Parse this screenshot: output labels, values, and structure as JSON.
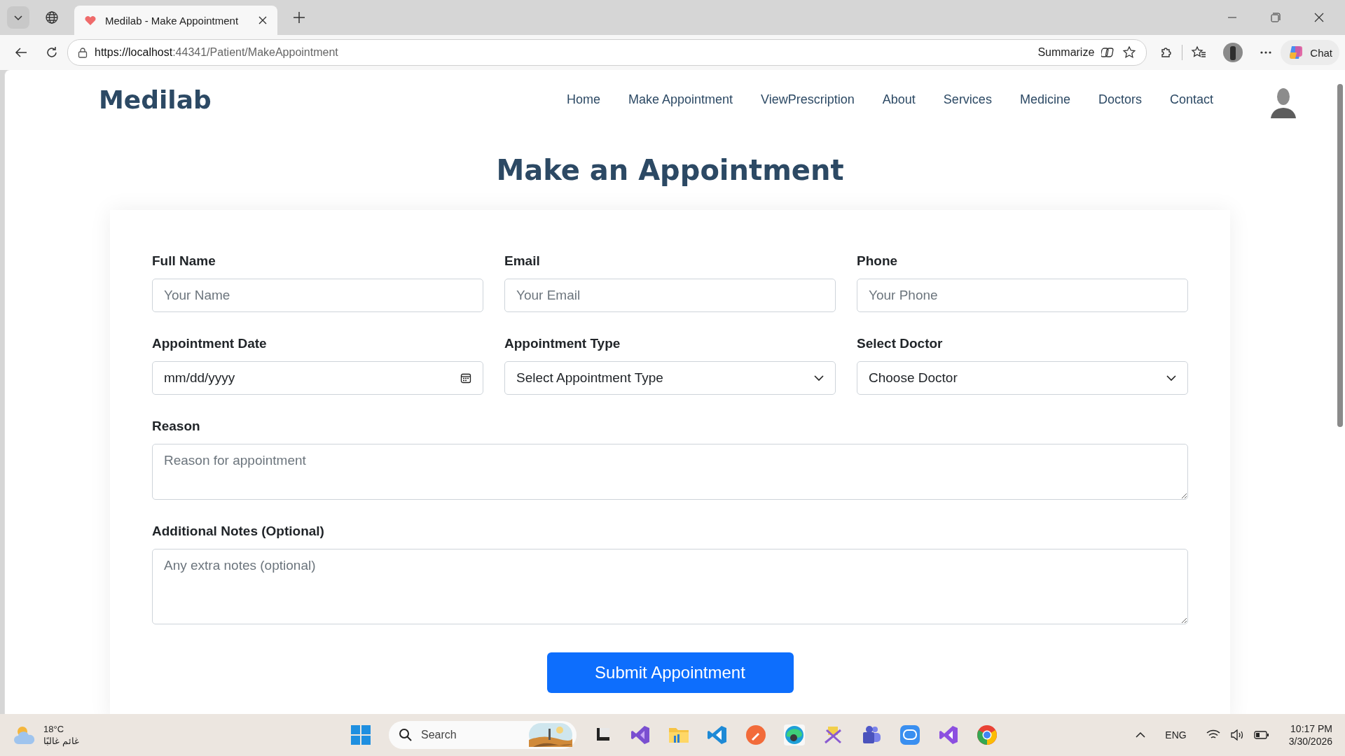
{
  "browser": {
    "tabs": [
      {
        "title": "Medilab - Make Appointment",
        "selected": true
      }
    ],
    "url_host": "https://localhost",
    "url_path": ":44341/Patient/MakeAppointment",
    "summarize": "Summarize",
    "chat": "Chat"
  },
  "site": {
    "logo": "Medilab",
    "nav": [
      "Home",
      "Make Appointment",
      "ViewPrescription",
      "About",
      "Services",
      "Medicine",
      "Doctors",
      "Contact"
    ]
  },
  "page_title": "Make an Appointment",
  "form": {
    "rows": [
      [
        {
          "label": "Full Name",
          "kind": "text",
          "placeholder": "Your Name"
        },
        {
          "label": "Email",
          "kind": "text",
          "placeholder": "Your Email"
        },
        {
          "label": "Phone",
          "kind": "text",
          "placeholder": "Your Phone"
        }
      ],
      [
        {
          "label": "Appointment Date",
          "kind": "date",
          "placeholder": "mm/dd/yyyy"
        },
        {
          "label": "Appointment Type",
          "kind": "select",
          "value": "Select Appointment Type"
        },
        {
          "label": "Select Doctor",
          "kind": "select",
          "value": "Choose Doctor"
        }
      ],
      [
        {
          "label": "Reason",
          "kind": "textarea",
          "placeholder": "Reason for appointment"
        }
      ],
      [
        {
          "label": "Additional Notes (Optional)",
          "kind": "textarea_tall",
          "placeholder": "Any extra notes (optional)"
        }
      ]
    ],
    "submit": "Submit Appointment"
  },
  "taskbar": {
    "weather_temp": "18°C",
    "weather_text": "غائم غالبًا",
    "search": "Search",
    "language": "ENG",
    "time": "10:17 PM",
    "date": "3/30/2026"
  }
}
